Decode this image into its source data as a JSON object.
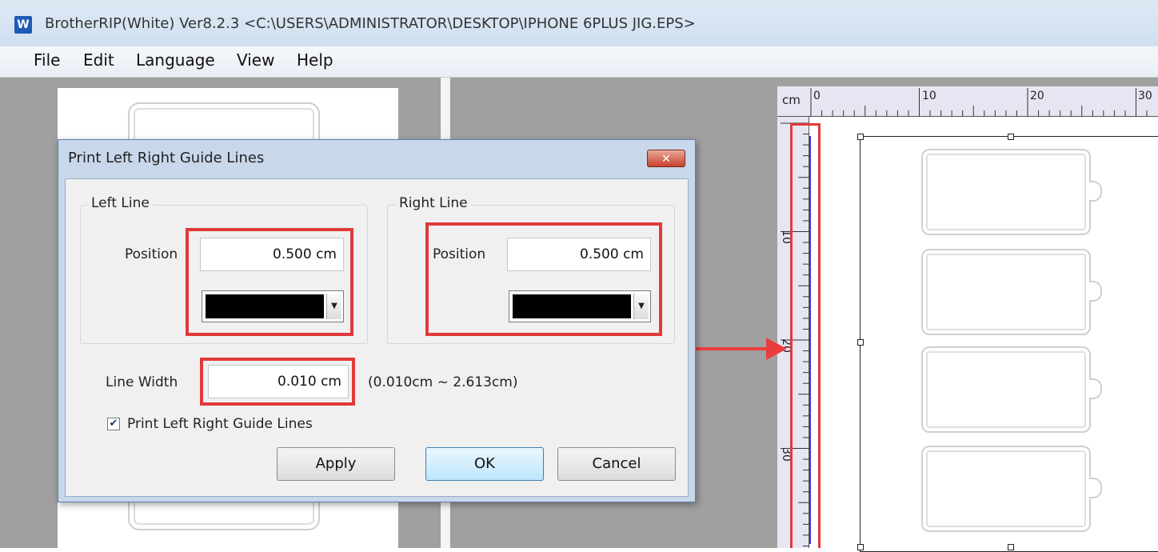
{
  "window": {
    "icon_letter": "W",
    "title": "BrotherRIP(White) Ver8.2.3 <C:\\USERS\\ADMINISTRATOR\\DESKTOP\\IPHONE 6PLUS JIG.EPS>"
  },
  "menu": [
    "File",
    "Edit",
    "Language",
    "View",
    "Help"
  ],
  "ruler": {
    "unit": "cm",
    "top_labels": [
      "0",
      "10",
      "20",
      "30"
    ],
    "left_labels": [
      "10",
      "20",
      "30"
    ]
  },
  "dialog": {
    "title": "Print Left Right Guide Lines",
    "close_glyph": "✕",
    "left_line": {
      "group_label": "Left Line",
      "position_label": "Position",
      "position_value": "0.500 cm",
      "color": "#000000"
    },
    "right_line": {
      "group_label": "Right Line",
      "position_label": "Position",
      "position_value": "0.500 cm",
      "color": "#000000"
    },
    "line_width": {
      "label": "Line Width",
      "value": "0.010 cm",
      "range": "(0.010cm ~ 2.613cm)"
    },
    "checkbox": {
      "label": "Print Left Right Guide Lines",
      "checked": true,
      "check_glyph": "✔"
    },
    "buttons": {
      "apply": "Apply",
      "ok": "OK",
      "cancel": "Cancel"
    }
  },
  "colors": {
    "highlight": "#e03a3a",
    "guide_line": "#3a3acc"
  }
}
